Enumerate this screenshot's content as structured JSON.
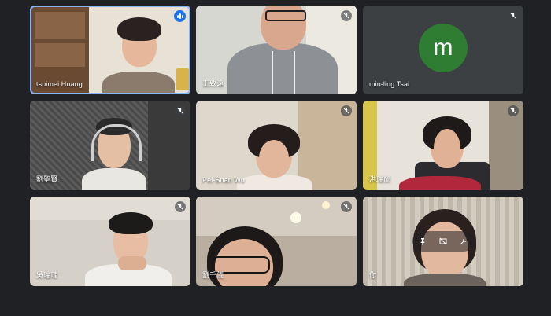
{
  "meeting": {
    "participants": [
      {
        "name": "tsuimei Huang",
        "mic": "speaking"
      },
      {
        "name": "王致遠",
        "mic": "muted"
      },
      {
        "name": "min-ling Tsai",
        "mic": "muted",
        "avatar_letter": "m",
        "avatar_color": "#2e7d32"
      },
      {
        "name": "劉聖賢",
        "mic": "muted"
      },
      {
        "name": "Pei-Shan Wu",
        "mic": "muted"
      },
      {
        "name": "洪瑞蘭",
        "mic": "muted"
      },
      {
        "name": "吳瑞璉",
        "mic": "muted"
      },
      {
        "name": "劉千儀",
        "mic": "muted"
      },
      {
        "name": "你",
        "mic": "muted",
        "hover_controls": [
          "pin-icon",
          "hide-self-view-icon",
          "minimize-icon"
        ]
      }
    ]
  },
  "colors": {
    "background": "#202124",
    "tile": "#3c4043",
    "active_border": "#8ab4f8",
    "speaking_badge": "#1a73e8"
  }
}
